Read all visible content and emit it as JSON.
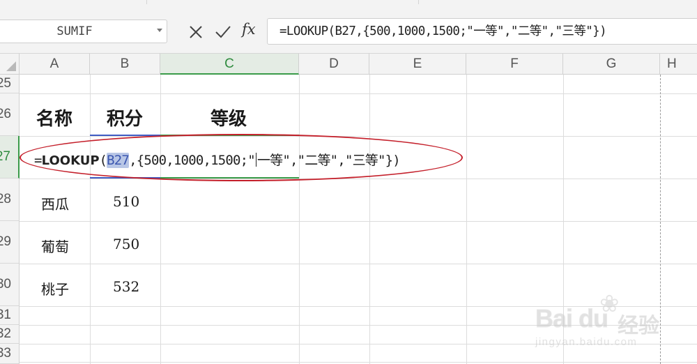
{
  "formula_bar": {
    "name_box": "SUMIF",
    "cancel_icon": "close-icon",
    "confirm_icon": "checkmark-icon",
    "fx_label": "fx",
    "formula": "=LOOKUP(B27,{500,1000,1500;\"一等\",\"二等\",\"三等\"})"
  },
  "columns": [
    "A",
    "B",
    "C",
    "D",
    "E",
    "F",
    "G",
    "H"
  ],
  "selected_column": "C",
  "rows": [
    "25",
    "26",
    "27",
    "28",
    "29",
    "30",
    "31",
    "32",
    "33"
  ],
  "selected_row": "27",
  "cells": {
    "A26": "名称",
    "B26": "积分",
    "C26": "等级",
    "A28": "西瓜",
    "B28": "510",
    "A29": "葡萄",
    "B29": "750",
    "A30": "桃子",
    "B30": "532"
  },
  "cell_edit": {
    "prefix": "=",
    "function": "LOOKUP",
    "open_paren": "(",
    "reference": "B27",
    "before_cursor": ",{500,1000,1500;\"",
    "after_cursor": "一等\",\"二等\",\"三等\"})"
  },
  "watermark": {
    "logo": "Bai du",
    "text": "经验",
    "url": "jingyan.baidu.com"
  },
  "colors": {
    "selection_green": "#3a9b49",
    "annotation_red": "#c41f2a",
    "reference_highlight": "#b8c6e6"
  }
}
